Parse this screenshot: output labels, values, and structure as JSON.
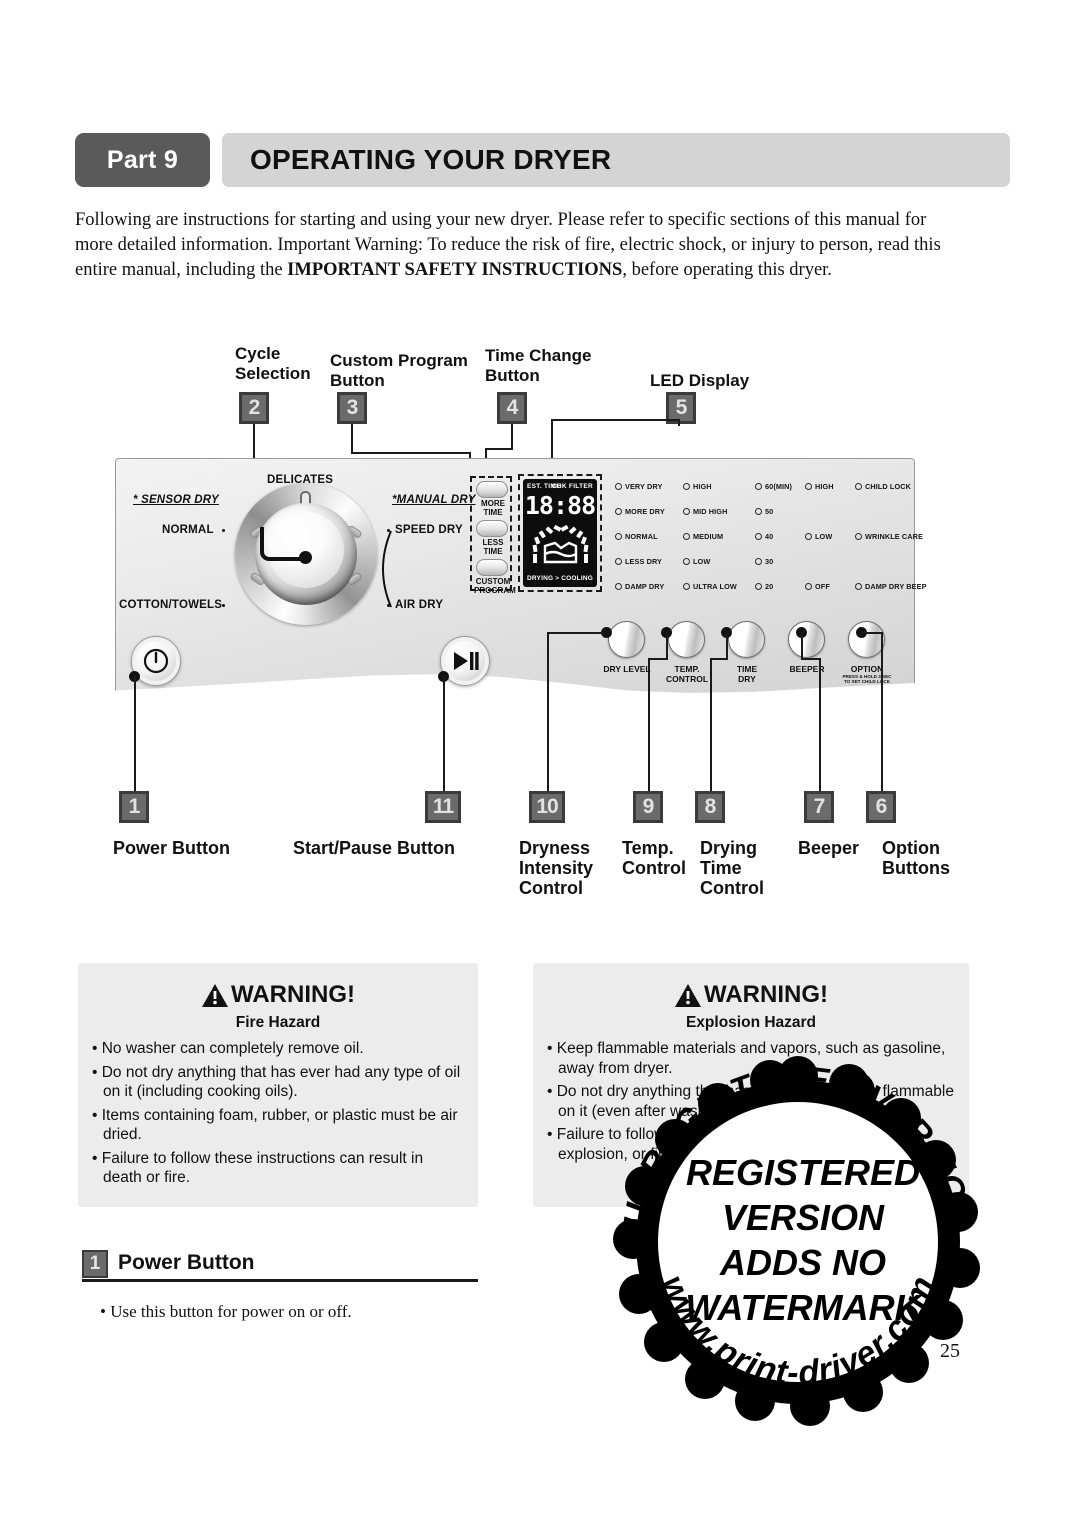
{
  "header": {
    "part_badge": "Part 9",
    "title": "OPERATING YOUR DRYER"
  },
  "intro": {
    "line1": "Following are instructions for starting and using your new dryer.  Please refer to specific sections of this manual for",
    "line2": "more detailed information.  Important Warning:  To reduce the risk of fire, electric shock, or injury to person, read",
    "line3_pre": "this entire manual, including the ",
    "line3_bold": "IMPORTANT SAFETY INSTRUCTIONS",
    "line3_post": ", before operating this dryer."
  },
  "diagram": {
    "top_callouts": [
      {
        "label": "Cycle\nSelection",
        "num": "2"
      },
      {
        "label": "Custom Program\nButton",
        "num": "3"
      },
      {
        "label": "Time Change\nButton",
        "num": "4"
      },
      {
        "label": "LED Display",
        "num": "5"
      }
    ],
    "bottom_callouts": [
      {
        "num": "1",
        "label": "Power Button"
      },
      {
        "num": "11",
        "label": "Start/Pause Button"
      },
      {
        "num": "10",
        "label": "Dryness\nIntensity\nControl"
      },
      {
        "num": "9",
        "label": "Temp.\nControl"
      },
      {
        "num": "8",
        "label": "Drying\nTime\nControl"
      },
      {
        "num": "7",
        "label": "Beeper"
      },
      {
        "num": "6",
        "label": "Option\nButtons"
      }
    ],
    "panel": {
      "dial": {
        "top_label": "DELICATES",
        "left_group": "* SENSOR DRY",
        "right_group": "*MANUAL DRY",
        "left_items": [
          "NORMAL",
          "COTTON/TOWELS"
        ],
        "right_items": [
          "SPEED DRY",
          "AIR DRY"
        ]
      },
      "side_buttons": [
        {
          "label": "MORE\nTIME"
        },
        {
          "label": "LESS\nTIME"
        },
        {
          "label": "CUSTOM\nPROGRAM"
        }
      ],
      "led_display": {
        "top_left": "EST. TIME",
        "top_right": "CHK FILTER",
        "digits": "18:88",
        "bottom": "DRYING  >  COOLING"
      },
      "indicator_columns": [
        {
          "name": "dry-level",
          "items": [
            "VERY DRY",
            "MORE DRY",
            "NORMAL",
            "LESS DRY",
            "DAMP DRY"
          ]
        },
        {
          "name": "temp-control",
          "items": [
            "HIGH",
            "MID HIGH",
            "MEDIUM",
            "LOW",
            "ULTRA LOW"
          ]
        },
        {
          "name": "time-dry",
          "items": [
            "60(MIN)",
            "50",
            "40",
            "30",
            "20"
          ]
        },
        {
          "name": "beeper",
          "items": [
            "HIGH",
            "",
            "LOW",
            "",
            "OFF"
          ]
        },
        {
          "name": "option",
          "items": [
            "CHILD LOCK",
            "",
            "WRINKLE CARE",
            "",
            "DAMP DRY BEEP"
          ]
        }
      ],
      "knobs": [
        {
          "label": "DRY LEVEL",
          "sub": ""
        },
        {
          "label": "TEMP.\nCONTROL",
          "sub": ""
        },
        {
          "label": "TIME\nDRY",
          "sub": ""
        },
        {
          "label": "BEEPER",
          "sub": ""
        },
        {
          "label": "OPTION",
          "sub": "PRESS & HOLD 3 SEC\nTO SET CHILD LOCK"
        }
      ]
    }
  },
  "warnings": [
    {
      "heading": "WARNING!",
      "subheading": "Fire Hazard",
      "items": [
        "No washer can completely remove oil.",
        "Do not dry anything that has ever had any type of oil on it (including cooking oils).",
        "Items containing foam, rubber, or plastic must be air dried.",
        "Failure to follow these instructions can result in death or fire."
      ]
    },
    {
      "heading": "WARNING!",
      "subheading": "Explosion Hazard",
      "items": [
        "Keep flammable materials and vapors, such as gasoline, away from dryer.",
        "Do not dry anything that has ever had anything flammable on it (even after washing).",
        "Failure to follow these instructions can result in death, explosion, or fire."
      ]
    }
  ],
  "section": {
    "badge": "1",
    "title": "Power Button",
    "bullet": "• Use this button for power on or off."
  },
  "watermark": {
    "ring_top": "UNREGISTERED VERSION",
    "center_line1": "REGISTERED",
    "center_line2": "VERSION",
    "center_line3": "ADDS NO",
    "center_line4": "WATERMARK",
    "ring_bottom": "www.print-driver.com"
  },
  "page_number": "25",
  "colors": {
    "badge_dark": "#5a5a5a",
    "header_bar": "#d4d4d4",
    "warn_bg": "#ececec",
    "ink": "#111111"
  }
}
